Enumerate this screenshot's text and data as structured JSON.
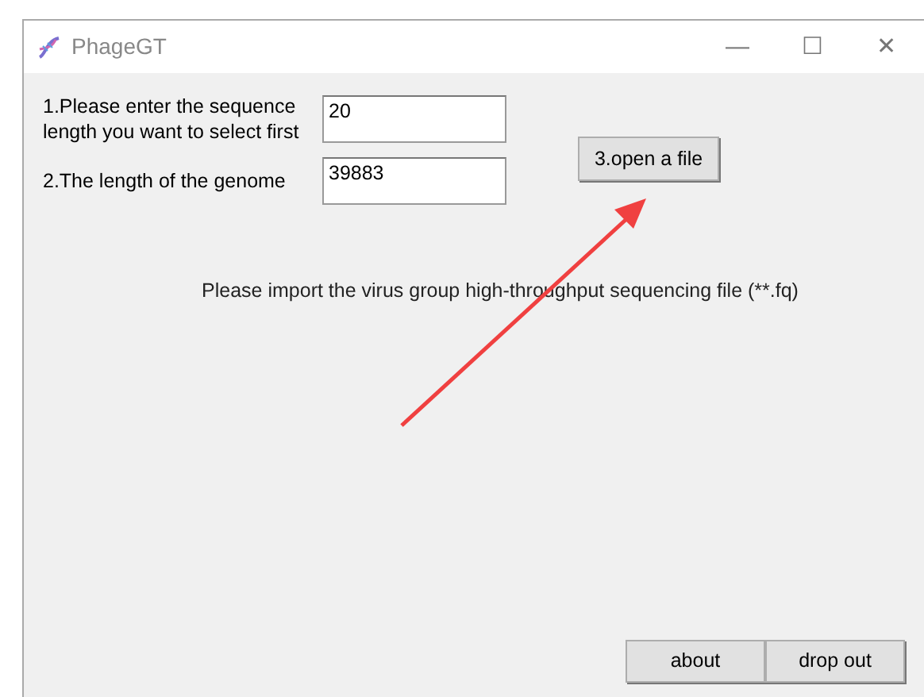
{
  "window": {
    "title": "PhageGT",
    "controls": [
      "—",
      "☐",
      "✕"
    ]
  },
  "fields": [
    {
      "label": "1.Please enter the sequence length you want to select first",
      "value": "20"
    },
    {
      "label": "2.The length of the genome",
      "value": "39883"
    }
  ],
  "open_button": "3.open a file",
  "message": "Please import the virus group high-throughput sequencing file (**.fq)",
  "buttons": [
    "about",
    "drop out"
  ]
}
